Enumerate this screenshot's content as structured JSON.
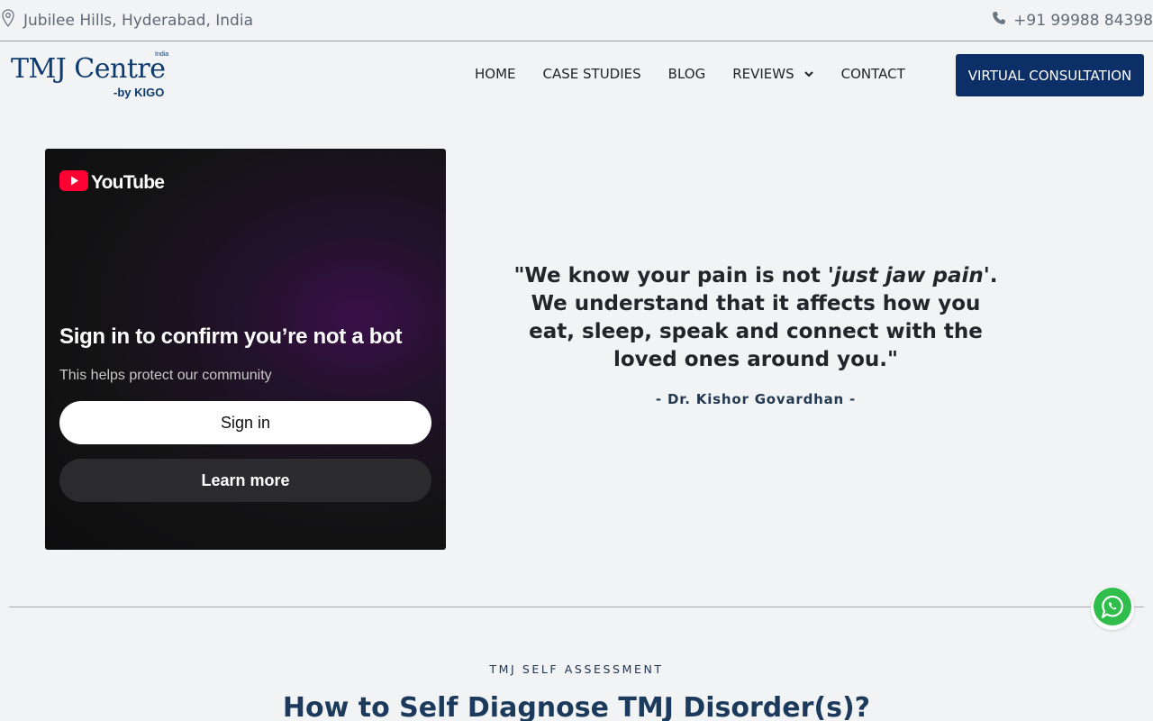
{
  "topbar": {
    "location": "Jubilee Hills, Hyderabad, India",
    "phone": "+91 99988 84398",
    "icons": {
      "location": "map-pin-icon",
      "phone": "phone-icon"
    }
  },
  "header": {
    "logo": {
      "brand": "TMJ Centre",
      "sub": "-by KIGO",
      "tag": "India"
    },
    "nav": [
      {
        "label": "HOME"
      },
      {
        "label": "CASE STUDIES"
      },
      {
        "label": "BLOG"
      },
      {
        "label": "REVIEWS"
      },
      {
        "label": "CONTACT"
      }
    ],
    "cta_label": "VIRTUAL CONSULTATION"
  },
  "video": {
    "brand": "YouTube",
    "title": "Sign in to confirm you’re not a bot",
    "subtitle": "This helps protect our community",
    "signin_label": "Sign in",
    "learn_more_label": "Learn more"
  },
  "quote": {
    "part1": "\"We know your pain is not ",
    "emphasis": "'just jaw pain'",
    "part2": ". We understand that it affects how you eat, sleep, speak and connect with the loved ones around you.\"",
    "author": "- Dr. Kishor Govardhan -"
  },
  "section": {
    "eyebrow": "TMJ SELF ASSESSMENT",
    "title": "How to Self Diagnose TMJ Disorder(s)?"
  },
  "colors": {
    "accent": "#0b2f66",
    "background": "#f1f3f5",
    "whatsapp": "#25d366"
  }
}
